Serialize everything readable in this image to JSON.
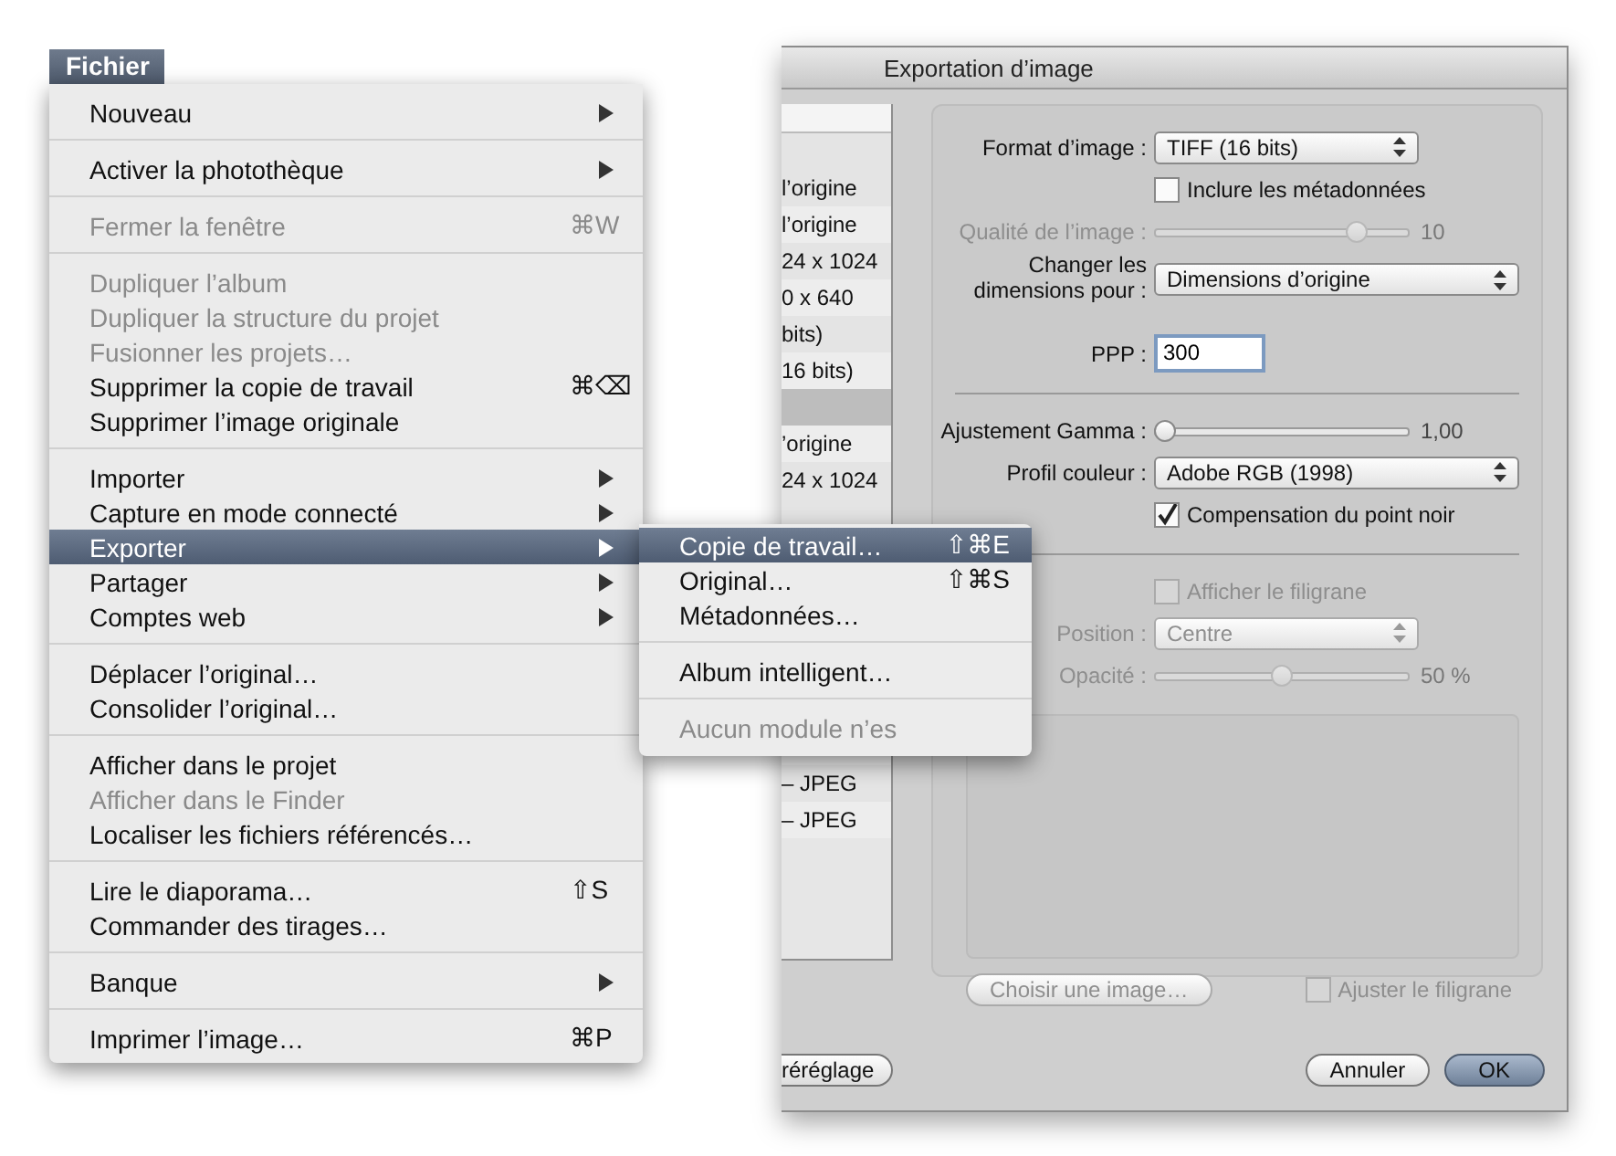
{
  "menu_bar": {
    "title": "Fichier",
    "selected": true
  },
  "file_menu": {
    "sections": [
      [
        {
          "label": "Nouveau",
          "has_submenu": true,
          "disabled": false,
          "selected": false
        }
      ],
      [
        {
          "label": "Activer la photothèque",
          "has_submenu": true,
          "disabled": false,
          "selected": false
        }
      ],
      [
        {
          "label": "Fermer la fenêtre",
          "shortcut": "⌘W",
          "has_submenu": false,
          "disabled": true,
          "selected": false
        }
      ],
      [
        {
          "label": "Dupliquer l’album",
          "has_submenu": false,
          "disabled": true,
          "selected": false
        },
        {
          "label": "Dupliquer la structure du projet",
          "has_submenu": false,
          "disabled": true,
          "selected": false
        },
        {
          "label": "Fusionner les projets…",
          "has_submenu": false,
          "disabled": true,
          "selected": false
        },
        {
          "label": "Supprimer la copie de travail",
          "shortcut": "⌘⌫",
          "has_submenu": false,
          "disabled": false,
          "selected": false
        },
        {
          "label": "Supprimer l’image originale",
          "has_submenu": false,
          "disabled": false,
          "selected": false
        }
      ],
      [
        {
          "label": "Importer",
          "has_submenu": true,
          "disabled": false,
          "selected": false
        },
        {
          "label": "Capture en mode connecté",
          "has_submenu": true,
          "disabled": false,
          "selected": false
        },
        {
          "label": "Exporter",
          "has_submenu": true,
          "disabled": false,
          "selected": true
        },
        {
          "label": "Partager",
          "has_submenu": true,
          "disabled": false,
          "selected": false
        },
        {
          "label": "Comptes web",
          "has_submenu": true,
          "disabled": false,
          "selected": false
        }
      ],
      [
        {
          "label": "Déplacer l’original…",
          "has_submenu": false,
          "disabled": false,
          "selected": false
        },
        {
          "label": "Consolider l’original…",
          "has_submenu": false,
          "disabled": false,
          "selected": false
        }
      ],
      [
        {
          "label": "Afficher dans le projet",
          "has_submenu": false,
          "disabled": false,
          "selected": false
        },
        {
          "label": "Afficher dans le Finder",
          "has_submenu": false,
          "disabled": true,
          "selected": false
        },
        {
          "label": "Localiser les fichiers référencés…",
          "has_submenu": false,
          "disabled": false,
          "selected": false
        }
      ],
      [
        {
          "label": "Lire le diaporama…",
          "shortcut": "⇧S",
          "has_submenu": false,
          "disabled": false,
          "selected": false
        },
        {
          "label": "Commander des tirages…",
          "has_submenu": false,
          "disabled": false,
          "selected": false
        }
      ],
      [
        {
          "label": "Banque",
          "has_submenu": true,
          "disabled": false,
          "selected": false
        }
      ],
      [
        {
          "label": "Imprimer l’image…",
          "shortcut": "⌘P",
          "has_submenu": false,
          "disabled": false,
          "selected": false
        }
      ]
    ]
  },
  "export_submenu": {
    "sections": [
      [
        {
          "label": "Copie de travail…",
          "shortcut": "⇧⌘E",
          "disabled": false,
          "selected": true
        },
        {
          "label": "Original…",
          "shortcut": "⇧⌘S",
          "disabled": false,
          "selected": false
        },
        {
          "label": "Métadonnées…",
          "disabled": false,
          "selected": false
        }
      ],
      [
        {
          "label": "Album intelligent…",
          "disabled": false,
          "selected": false
        }
      ],
      [
        {
          "label": "Aucun module n’es",
          "disabled": true,
          "selected": false
        }
      ]
    ]
  },
  "dialog": {
    "title": "Exportation d’image",
    "preset_list": {
      "rows": [
        {
          "kind": "item",
          "text": "l’origine"
        },
        {
          "kind": "item",
          "text": "l’origine"
        },
        {
          "kind": "item",
          "text": "24 x 1024"
        },
        {
          "kind": "item",
          "text": "0 x 640"
        },
        {
          "kind": "item",
          "text": "bits)"
        },
        {
          "kind": "item",
          "text": "16 bits)"
        },
        {
          "kind": "group"
        },
        {
          "kind": "item",
          "text": "’origine"
        },
        {
          "kind": "item",
          "text": "24 x 1024"
        }
      ],
      "rows_lower": [
        {
          "kind": "item",
          "text": "– JPEG"
        },
        {
          "kind": "item",
          "text": "– JPEG"
        }
      ]
    },
    "settings": [
      {
        "kind": "popup",
        "label": "Format d’image :",
        "value": "TIFF (16 bits)",
        "disabled": false
      },
      {
        "kind": "checkbox",
        "text": "Inclure les métadonnées",
        "checked": false,
        "disabled": false
      },
      {
        "kind": "slider",
        "label": "Qualité de l’image :",
        "level": 0.82,
        "reading": "10",
        "disabled": true
      },
      {
        "kind": "popup",
        "label": "Changer les dimensions pour :",
        "value": "Dimensions d’origine",
        "disabled": false
      },
      {
        "kind": "field",
        "label": "PPP :",
        "value": "300"
      },
      {
        "kind": "separator"
      },
      {
        "kind": "slider",
        "label": "Ajustement Gamma :",
        "level": 0,
        "reading": "1,00",
        "disabled": false
      },
      {
        "kind": "popup",
        "label": "Profil couleur :",
        "value": "Adobe RGB (1998)",
        "disabled": false
      },
      {
        "kind": "checkbox",
        "text": "Compensation du point noir",
        "checked": true,
        "disabled": false
      },
      {
        "kind": "separator"
      },
      {
        "kind": "checkbox",
        "text": "Afficher le filigrane",
        "checked": false,
        "disabled": true
      },
      {
        "kind": "popup",
        "label": "Position :",
        "value": "Centre",
        "disabled": true
      },
      {
        "kind": "slider",
        "label": "Opacité :",
        "level": 0.5,
        "reading": "50 %",
        "disabled": true
      }
    ],
    "choose_button": {
      "label": "Choisir une image…",
      "disabled": true
    },
    "fit_checkbox": {
      "text": "Ajuster le filigrane",
      "checked": false,
      "disabled": true
    },
    "preset_button": {
      "label": "réréglage"
    },
    "buttons": [
      {
        "label": "Annuler",
        "default": false
      },
      {
        "label": "OK",
        "default": true
      }
    ]
  }
}
